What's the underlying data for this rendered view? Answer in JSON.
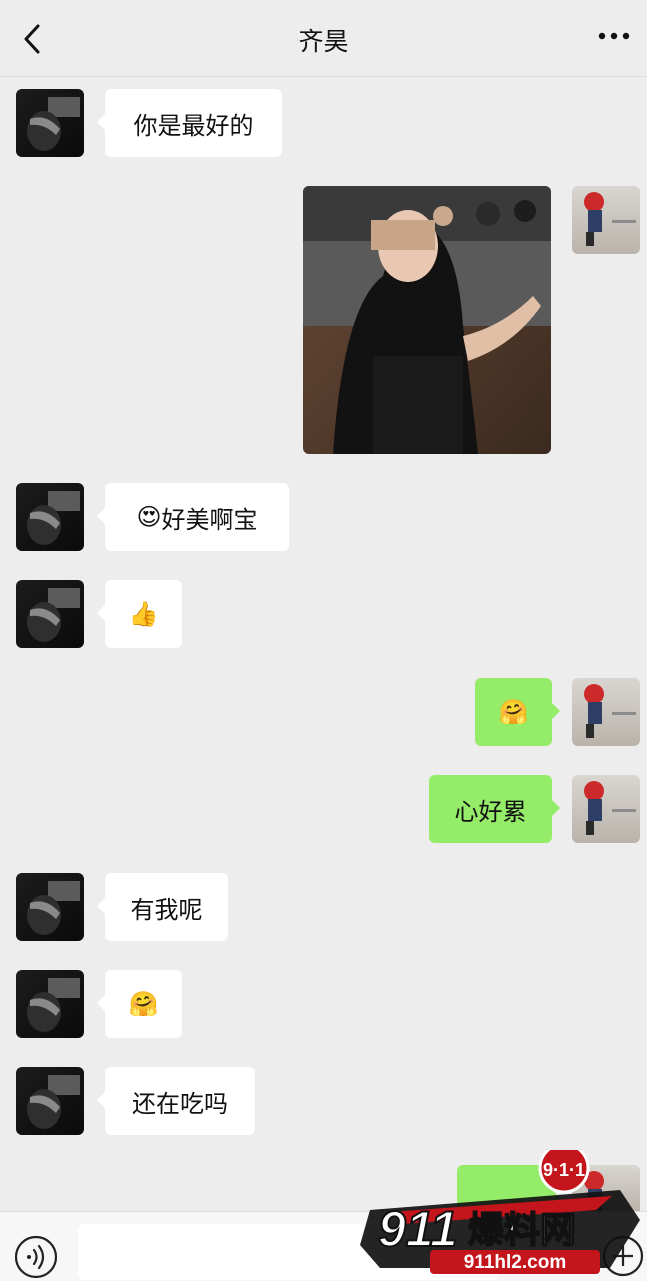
{
  "header": {
    "title": "齐昊",
    "back_icon": "chevron-left-icon",
    "more_icon": "more-dots-icon"
  },
  "messages": [
    {
      "from": "contact",
      "text": "你是最好的"
    },
    {
      "from": "me",
      "type": "image",
      "content": "photo-selfie"
    },
    {
      "from": "contact",
      "emoji": "😍",
      "text": "好美啊宝"
    },
    {
      "from": "contact",
      "emoji": "👍"
    },
    {
      "from": "me",
      "emoji": "🤗"
    },
    {
      "from": "me",
      "text": "心好累"
    },
    {
      "from": "contact",
      "text": "有我呢"
    },
    {
      "from": "contact",
      "emoji": "🤗"
    },
    {
      "from": "contact",
      "text": "还在吃吗"
    }
  ],
  "colors": {
    "background": "#ededed",
    "incoming_bubble": "#ffffff",
    "outgoing_bubble": "#95ec69"
  },
  "footer": {
    "voice_icon": "voice-icon",
    "plus_icon": "plus-circle-icon"
  },
  "watermark": {
    "brand": "911爆料网",
    "badge": "9·1·1",
    "url": "911hl2.com"
  }
}
